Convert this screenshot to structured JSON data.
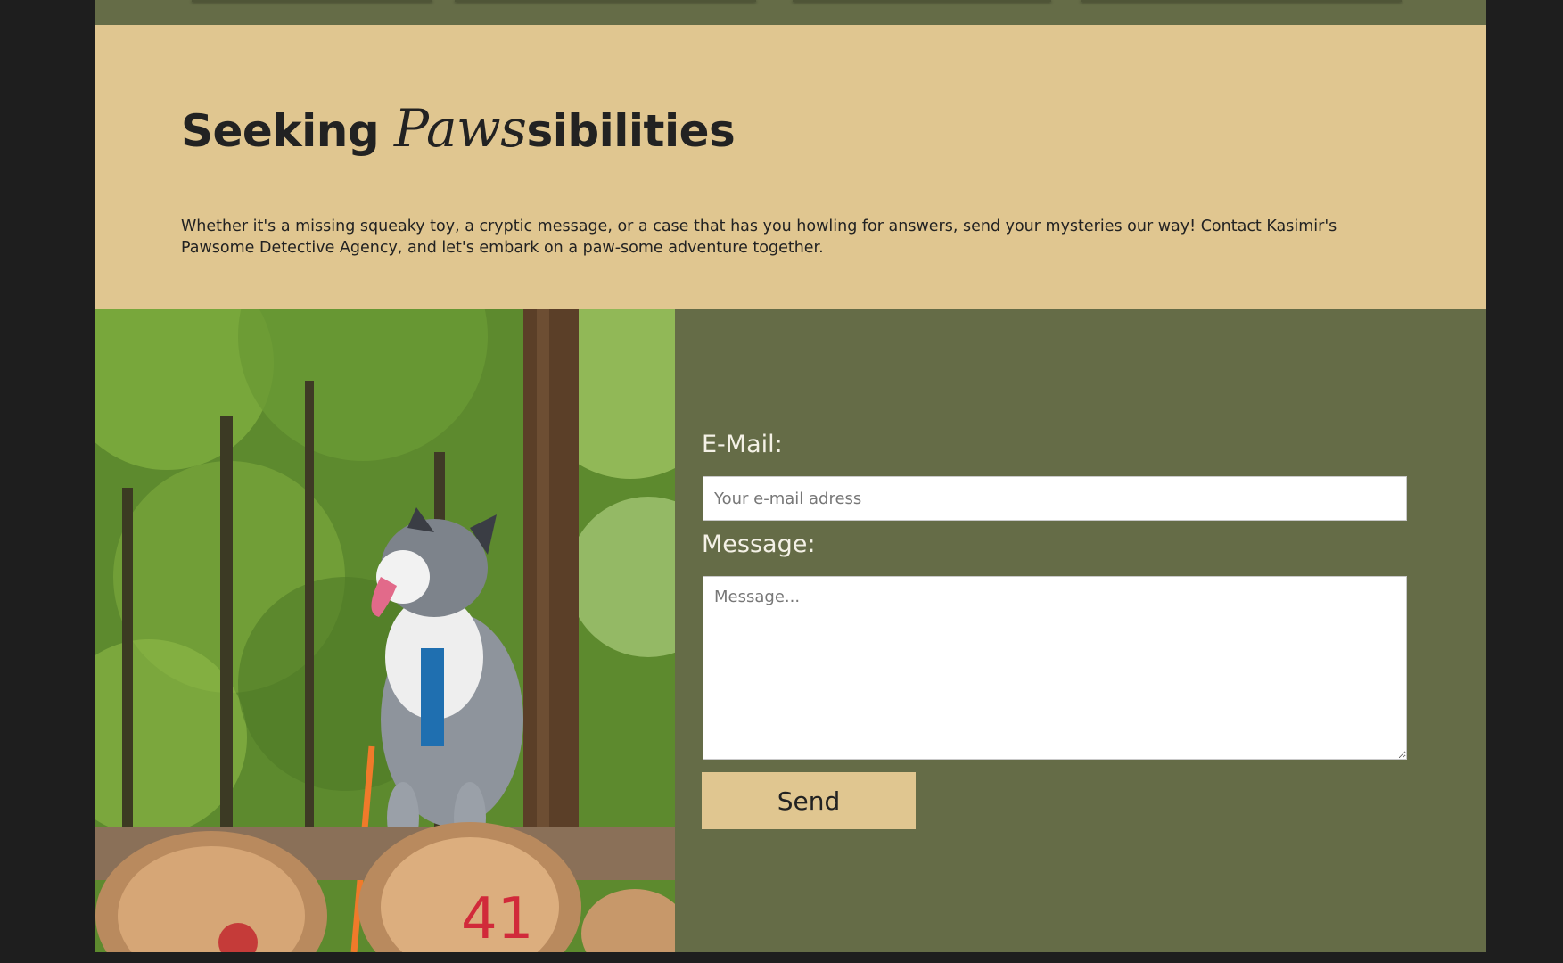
{
  "hero": {
    "title_before": "Seeking ",
    "title_script": "Paws",
    "title_after": "sibilities",
    "intro": "Whether it's a missing squeaky toy, a cryptic message, or a case that has you howling for answers, send your mysteries our way! Contact Kasimir's\nPawsome Detective Agency, and let's embark on a paw-some adventure together."
  },
  "photo": {
    "log_marking": "41"
  },
  "form": {
    "email_label": "E-Mail:",
    "email_placeholder": "Your e-mail adress",
    "message_label": "Message:",
    "message_placeholder": "Message...",
    "send_label": "Send"
  },
  "colors": {
    "cream": "#e0c690",
    "olive": "#656c47",
    "backdrop": "#1e1e1e",
    "text_dark": "#222222"
  }
}
